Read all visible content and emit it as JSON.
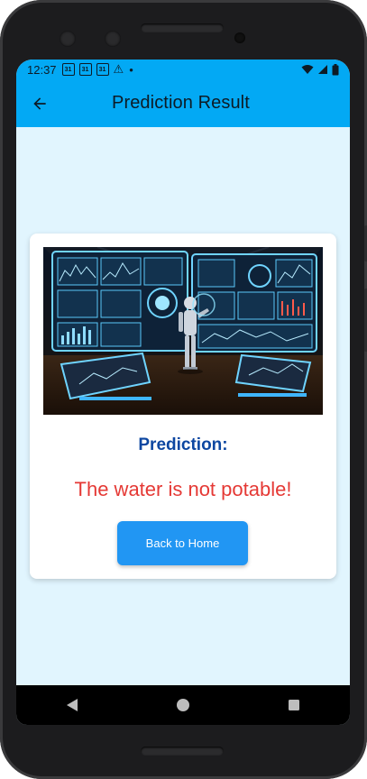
{
  "status_bar": {
    "time": "12:37",
    "calendar_badge": "31",
    "dot": "•"
  },
  "app_bar": {
    "title": "Prediction Result",
    "color": "#03a9f4"
  },
  "card": {
    "image_icon": "robot-control-room-image",
    "label": "Prediction:",
    "result": "The water is not potable!",
    "result_color": "#e53935",
    "button_label": "Back to Home"
  },
  "nav_bar": {
    "icons": [
      "back-triangle-icon",
      "home-circle-icon",
      "recents-square-icon"
    ]
  }
}
